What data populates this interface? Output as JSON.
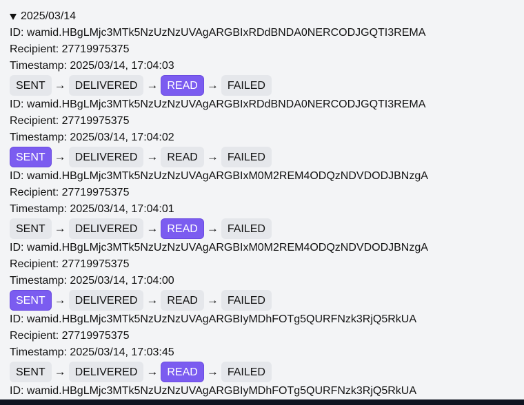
{
  "group": {
    "date_label": "2025/03/14"
  },
  "statuses": [
    "SENT",
    "DELIVERED",
    "READ",
    "FAILED"
  ],
  "arrow": "→",
  "colors": {
    "active": "#7b5cf0",
    "inactive": "#e5e7eb",
    "background": "#f3f4f6"
  },
  "messages": [
    {
      "id_text": "ID: wamid.HBgLMjc3MTk5NzUzNzUVAgARGBIxRDdBNDA0NERCODJGQTI3REMA",
      "recipient_text": "Recipient: 27719975375",
      "timestamp_text": "Timestamp: 2025/03/14, 17:04:03",
      "active_status": "READ"
    },
    {
      "id_text": "ID: wamid.HBgLMjc3MTk5NzUzNzUVAgARGBIxRDdBNDA0NERCODJGQTI3REMA",
      "recipient_text": "Recipient: 27719975375",
      "timestamp_text": "Timestamp: 2025/03/14, 17:04:02",
      "active_status": "SENT"
    },
    {
      "id_text": "ID: wamid.HBgLMjc3MTk5NzUzNzUVAgARGBIxM0M2REM4ODQzNDVDODJBNzgA",
      "recipient_text": "Recipient: 27719975375",
      "timestamp_text": "Timestamp: 2025/03/14, 17:04:01",
      "active_status": "READ"
    },
    {
      "id_text": "ID: wamid.HBgLMjc3MTk5NzUzNzUVAgARGBIxM0M2REM4ODQzNDVDODJBNzgA",
      "recipient_text": "Recipient: 27719975375",
      "timestamp_text": "Timestamp: 2025/03/14, 17:04:00",
      "active_status": "SENT"
    },
    {
      "id_text": "ID: wamid.HBgLMjc3MTk5NzUzNzUVAgARGBIyMDhFOTg5QURFNzk3RjQ5RkUA",
      "recipient_text": "Recipient: 27719975375",
      "timestamp_text": "Timestamp: 2025/03/14, 17:03:45",
      "active_status": "READ"
    },
    {
      "id_text": "ID: wamid.HBgLMjc3MTk5NzUzNzUVAgARGBIyMDhFOTg5QURFNzk3RjQ5RkUA",
      "recipient_text": "",
      "timestamp_text": "",
      "active_status": ""
    }
  ]
}
